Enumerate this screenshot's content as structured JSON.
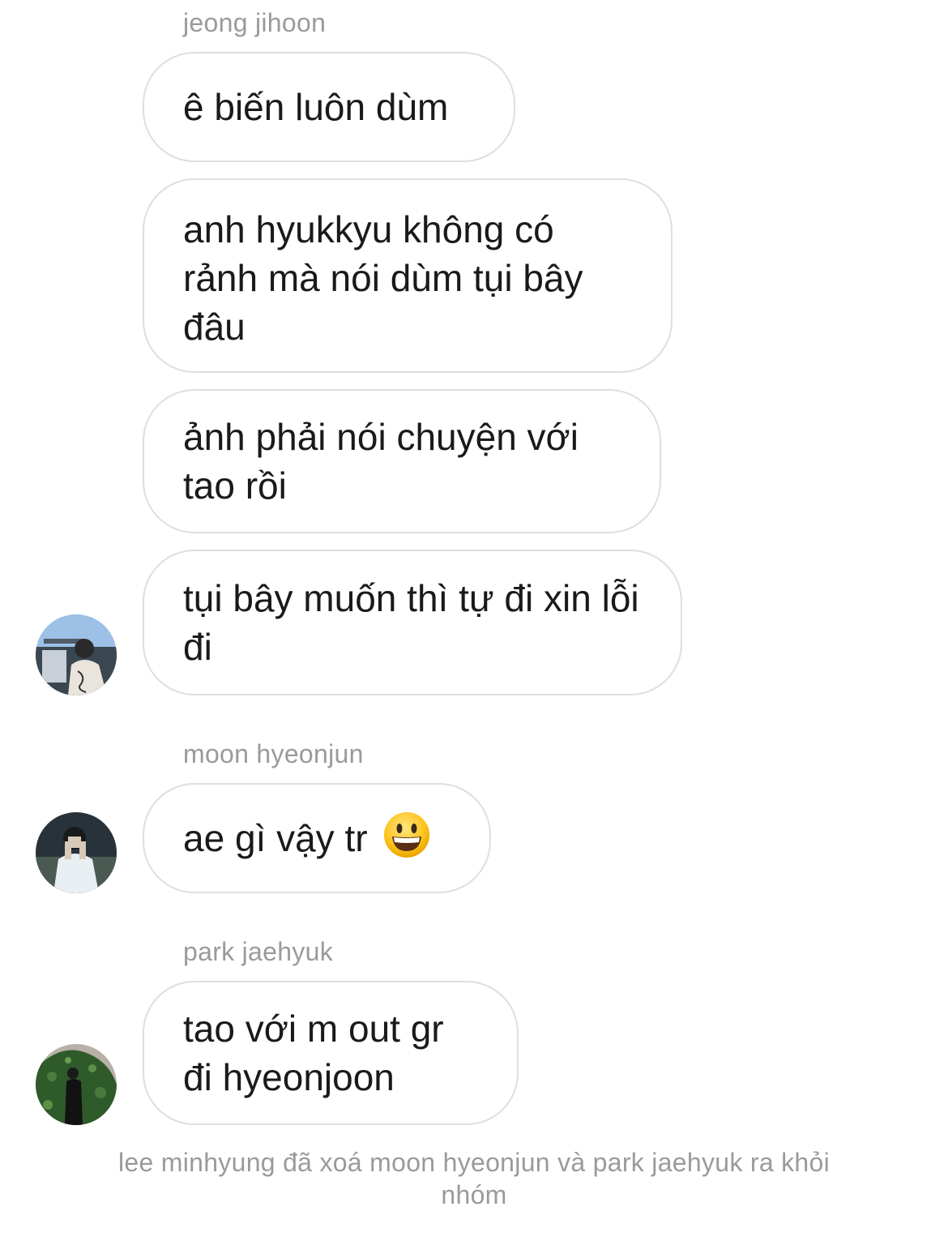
{
  "thread": {
    "groups": [
      {
        "sender": "jeong jihoon",
        "messages": [
          "ê biến luôn dùm",
          "anh hyukkyu không có rảnh mà nói dùm tụi bây đâu",
          "ảnh phải nói chuyện với tao rồi",
          "tụi bây muốn thì tự đi xin lỗi đi"
        ],
        "avatar": "avatar-photo"
      },
      {
        "sender": "moon hyeonjun",
        "messages": [
          "ae gì vậy tr"
        ],
        "emoji": "grinning-face-emoji",
        "avatar": "avatar-photo"
      },
      {
        "sender": "park jaehyuk",
        "messages": [
          "tao với m out gr đi hyeonjoon"
        ],
        "avatar": "avatar-photo"
      }
    ],
    "system_notice": "lee minhyung đã xoá moon hyeonjun và park jaehyuk ra khỏi nhóm"
  },
  "colors": {
    "bubble_border": "#dedede",
    "secondary_text": "#9a9a9a",
    "message_text": "#1a1a1a",
    "background": "#ffffff"
  }
}
